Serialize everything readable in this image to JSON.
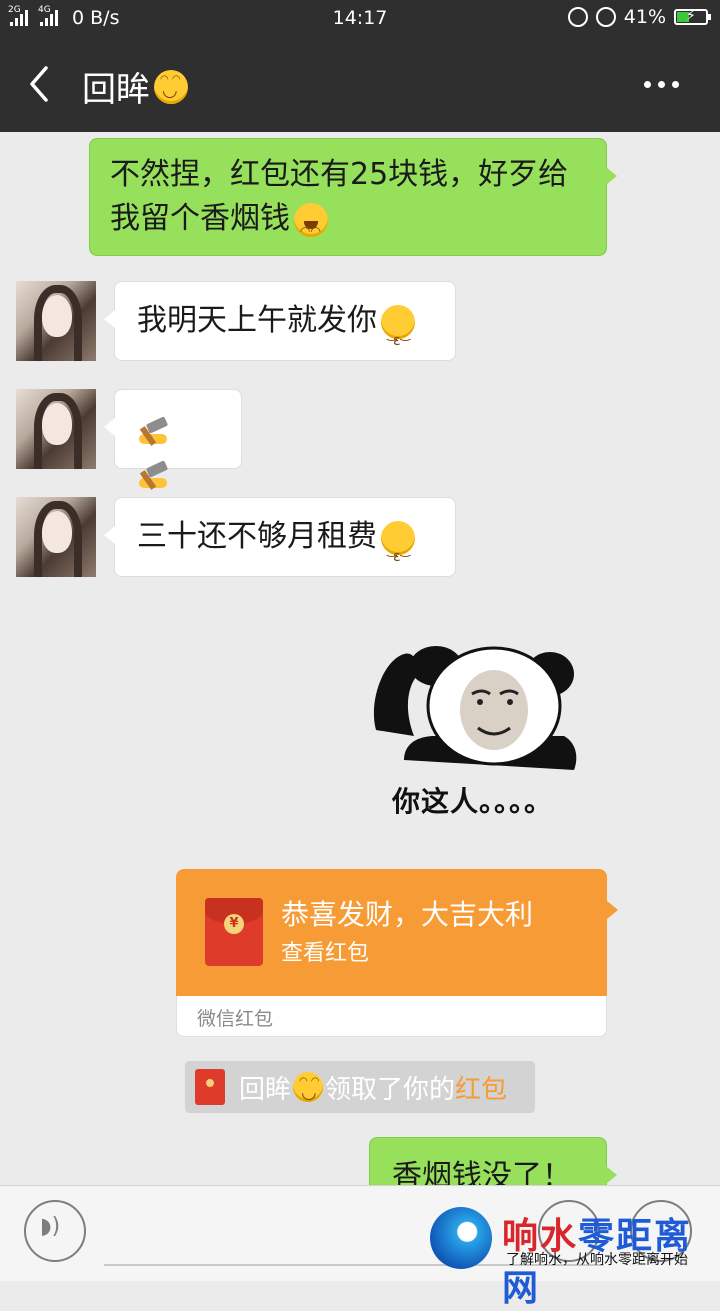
{
  "status_bar": {
    "network1": "2G",
    "network2": "4G",
    "speed": "0 B/s",
    "time": "14:17",
    "battery": "41%"
  },
  "header": {
    "title": "回眸",
    "title_emoji": "smile-emoji"
  },
  "messages": [
    {
      "side": "out",
      "text": "不然捏，红包还有25块钱，好歹给我留个香烟钱",
      "emoji": "crying-laughing-emoji"
    },
    {
      "side": "in",
      "text": "我明天上午就发你",
      "emoji": "kissing-emoji"
    },
    {
      "side": "in",
      "emoji": "hammer-emoji x2"
    },
    {
      "side": "in",
      "text": "三十还不够月租费",
      "emoji": "kissing-emoji"
    }
  ],
  "sticker": {
    "caption": "你这人。。。。"
  },
  "red_packet": {
    "greeting": "恭喜发财，大吉大利",
    "action": "查看红包",
    "footer": "微信红包"
  },
  "notice": {
    "prefix": "回眸",
    "middle": "领取了你的",
    "link": "红包"
  },
  "last_message": {
    "text": "香烟钱没了！"
  },
  "watermark": {
    "brand_part1": "响水",
    "brand_part2": "零距离网",
    "slogan": "了解响水，从响水零距离开始"
  },
  "colors": {
    "bar": "#2f2f2f",
    "out_bubble": "#96e05c",
    "red_packet": "#f79b36",
    "background": "#ebebeb"
  }
}
